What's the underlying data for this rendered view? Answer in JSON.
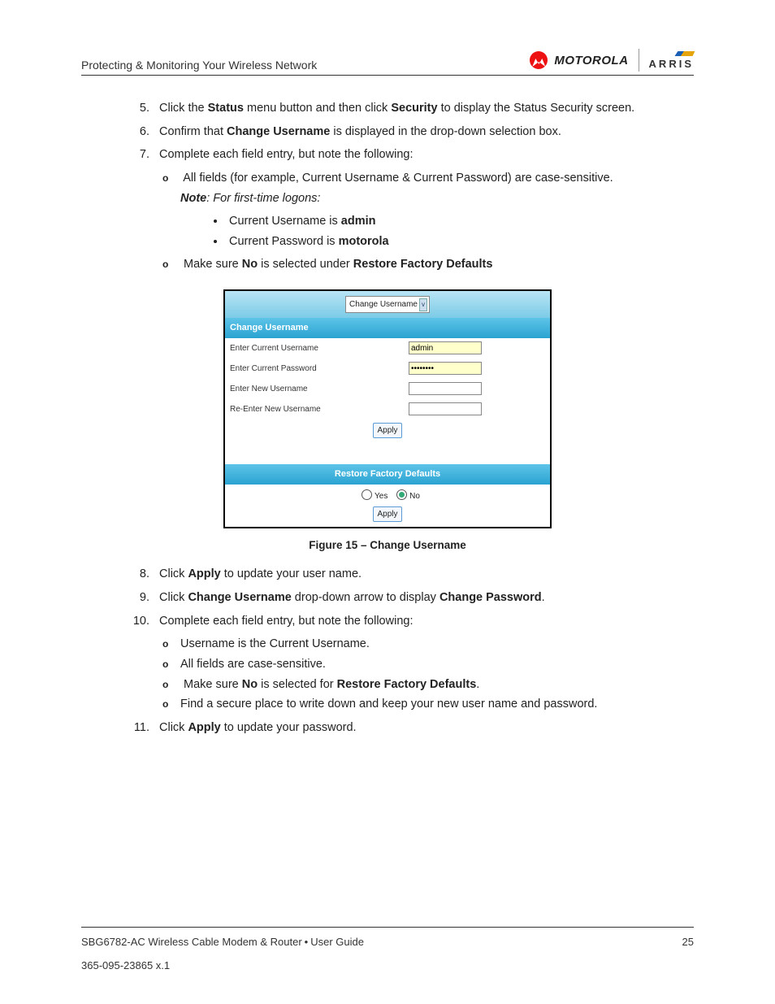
{
  "header": {
    "section_title": "Protecting & Monitoring Your Wireless Network",
    "brand1": "MOTOROLA",
    "brand2": "ARRIS"
  },
  "steps": {
    "s5_a": "Click the ",
    "s5_b": "Status",
    "s5_c": " menu button and then click ",
    "s5_d": "Security",
    "s5_e": " to display the Status Security screen.",
    "s6_a": "Confirm that ",
    "s6_b": "Change Username",
    "s6_c": " is displayed in the drop-down selection box.",
    "s7": "Complete each field entry, but note the following:",
    "s7_o1": "All fields (for example, Current Username & Current Password) are case-sensitive.",
    "s7_note_b": "Note",
    "s7_note_i": ": For first-time logons:",
    "s7_b1_a": "Current Username is ",
    "s7_b1_b": "admin",
    "s7_b2_a": "Current Password is ",
    "s7_b2_b": "motorola",
    "s7_o2_a": "Make sure ",
    "s7_o2_b": "No",
    "s7_o2_c": " is selected under ",
    "s7_o2_d": "Restore Factory Defaults",
    "s8_a": "Click ",
    "s8_b": "Apply",
    "s8_c": " to update your user name.",
    "s9_a": "Click ",
    "s9_b": "Change Username",
    "s9_c": " drop-down arrow to display ",
    "s9_d": "Change Password",
    "s9_e": ".",
    "s10": "Complete each field entry, but note the following:",
    "s10_o1": "Username is the Current Username.",
    "s10_o2": "All fields are case-sensitive.",
    "s10_o3_a": "Make sure ",
    "s10_o3_b": "No",
    "s10_o3_c": " is selected for ",
    "s10_o3_d": "Restore Factory Defaults",
    "s10_o3_e": ".",
    "s10_o4": "Find a secure place to write down and keep your new user name and password.",
    "s11_a": "Click ",
    "s11_b": "Apply",
    "s11_c": " to update your password."
  },
  "figure": {
    "dropdown_label": "Change Username",
    "section1_title": "Change Username",
    "row1": "Enter Current Username",
    "row1_val": "admin",
    "row2": "Enter Current Password",
    "row2_val": "••••••••",
    "row3": "Enter New Username",
    "row4": "Re-Enter New Username",
    "apply": "Apply",
    "section2_title": "Restore Factory Defaults",
    "yes": "Yes",
    "no": "No",
    "caption": "Figure 15 – Change Username"
  },
  "footer": {
    "left_a": "SBG6782-AC Wireless Cable Modem & Router",
    "left_b": "User Guide",
    "page": "25",
    "docnum": "365-095-23865  x.1"
  }
}
